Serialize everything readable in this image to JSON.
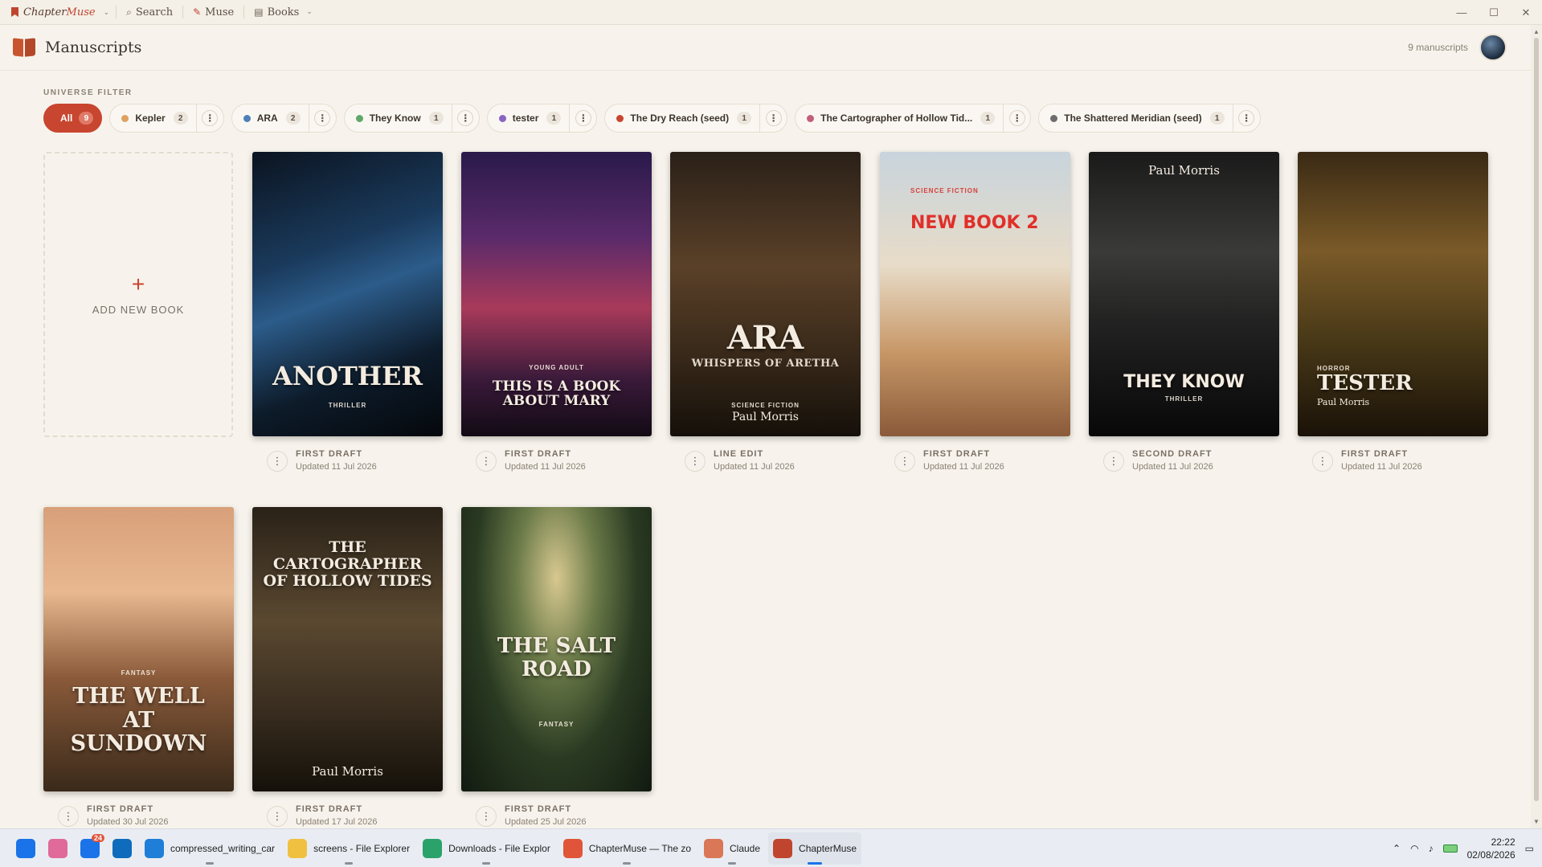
{
  "titlebar": {
    "app_name_prefix": "Chapter",
    "app_name_accent": "Muse",
    "menu": [
      {
        "label": "Search",
        "icon": "search-icon"
      },
      {
        "label": "Muse",
        "icon": "feather-icon"
      },
      {
        "label": "Books",
        "icon": "book-icon"
      }
    ],
    "window_controls": [
      "—",
      "☐",
      "✕"
    ]
  },
  "header": {
    "title": "Manuscripts",
    "manuscript_count": "9 manuscripts"
  },
  "filter": {
    "label": "UNIVERSE FILTER",
    "chips": [
      {
        "label": "All",
        "count": "9",
        "active": true
      },
      {
        "label": "Kepler",
        "count": "2",
        "color": "#e0a060"
      },
      {
        "label": "ARA",
        "count": "2",
        "color": "#4f7fb8"
      },
      {
        "label": "They Know",
        "count": "1",
        "color": "#5fa86a"
      },
      {
        "label": "tester",
        "count": "1",
        "color": "#8a64c2"
      },
      {
        "label": "The Dry Reach (seed)",
        "count": "1",
        "color": "#c8452f"
      },
      {
        "label": "The Cartographer of Hollow Tid...",
        "count": "1",
        "color": "#c25f7a"
      },
      {
        "label": "The Shattered Meridian (seed)",
        "count": "1",
        "color": "#6e6e6e"
      }
    ]
  },
  "add_book": {
    "label": "ADD NEW BOOK"
  },
  "books": [
    {
      "title": "ANOTHER",
      "genre": "THRILLER",
      "author": "",
      "stage": "FIRST DRAFT",
      "updated": "Updated 11 Jul 2026",
      "bg": "linear-gradient(160deg,#0b1420 0%,#1a3a5c 35%,#2c5c8a 50%,#0d1b2a 75%,#05080c 100%)"
    },
    {
      "title": "THIS IS A BOOK ABOUT MARY",
      "genre": "YOUNG ADULT",
      "author": "",
      "stage": "FIRST DRAFT",
      "updated": "Updated 11 Jul 2026",
      "bg": "linear-gradient(180deg,#2a1a4a 0%,#5a2a6a 30%,#a83a5a 55%,#3a1a3a 80%,#120a14 100%)"
    },
    {
      "title": "ARA",
      "subtitle": "WHISPERS OF ARETHA",
      "genre": "SCIENCE FICTION",
      "author": "Paul Morris",
      "stage": "LINE EDIT",
      "updated": "Updated 11 Jul 2026",
      "bg": "linear-gradient(180deg,#2a2018 0%,#5a4028 40%,#3a2a1a 70%,#15100a 100%)"
    },
    {
      "title": "NEW BOOK 2",
      "genre": "SCIENCE FICTION",
      "author": "",
      "stage": "FIRST DRAFT",
      "updated": "Updated 11 Jul 2026",
      "bg": "linear-gradient(180deg,#c8d4dc 0%,#e8dcc8 40%,#c89868 70%,#8a5a3a 100%)"
    },
    {
      "title": "THEY KNOW",
      "genre": "THRILLER",
      "author": "Paul Morris",
      "stage": "SECOND DRAFT",
      "updated": "Updated 11 Jul 2026",
      "bg": "linear-gradient(180deg,#1a1a1a 0%,#3a3a38 35%,#222 60%,#080808 100%)"
    },
    {
      "title": "TESTER",
      "genre": "HORROR",
      "author": "Paul Morris",
      "stage": "FIRST DRAFT",
      "updated": "Updated 11 Jul 2026",
      "bg": "linear-gradient(180deg,#3a2a14 0%,#7a5a28 35%,#4a3a18 65%,#1a1208 100%)"
    },
    {
      "title": "THE WELL AT SUNDOWN",
      "genre": "FANTASY",
      "author": "",
      "stage": "FIRST DRAFT",
      "updated": "Updated 30 Jul 2026",
      "bg": "linear-gradient(180deg,#d8a07a 0%,#e8b890 30%,#8a5a3a 60%,#3a2a1a 100%)"
    },
    {
      "title": "THE CARTOGRAPHER OF HOLLOW TIDES",
      "genre": "",
      "author": "Paul Morris",
      "stage": "FIRST DRAFT",
      "updated": "Updated 17 Jul 2026",
      "bg": "linear-gradient(180deg,#2a2218 0%,#5a4830 40%,#3a2e20 70%,#15110a 100%)"
    },
    {
      "title": "THE SALT ROAD",
      "genre": "FANTASY",
      "author": "",
      "stage": "FIRST DRAFT",
      "updated": "Updated 25 Jul 2026",
      "bg": "radial-gradient(ellipse at 50% 25%,#d8c890 0%,#6a7a48 30%,#2a3a22 60%,#121a10 100%)"
    }
  ],
  "taskbar": {
    "items": [
      {
        "label": "",
        "icon": "windows-start-icon",
        "color": "#1a73e8"
      },
      {
        "label": "",
        "icon": "copilot-icon",
        "color": "#e06a9a"
      },
      {
        "label": "",
        "icon": "mail-icon",
        "color": "#1a73e8",
        "badge": "24"
      },
      {
        "label": "",
        "icon": "outlook-icon",
        "color": "#0f6cbd"
      },
      {
        "label": "compressed_writing_car",
        "icon": "vscode-icon",
        "color": "#1f7ed8"
      },
      {
        "label": "screens - File Explorer",
        "icon": "folder-icon",
        "color": "#f0c040"
      },
      {
        "label": "Downloads - File Explor",
        "icon": "download-icon",
        "color": "#2aa26a"
      },
      {
        "label": "ChapterMuse — The zo",
        "icon": "chrome-icon",
        "color": "#e0553a"
      },
      {
        "label": "Claude",
        "icon": "claude-icon",
        "color": "#d97757"
      },
      {
        "label": "ChapterMuse",
        "icon": "chaptermuse-icon",
        "color": "#c0452f",
        "active": true
      }
    ],
    "time": "22:22",
    "date": "02/08/2026"
  }
}
